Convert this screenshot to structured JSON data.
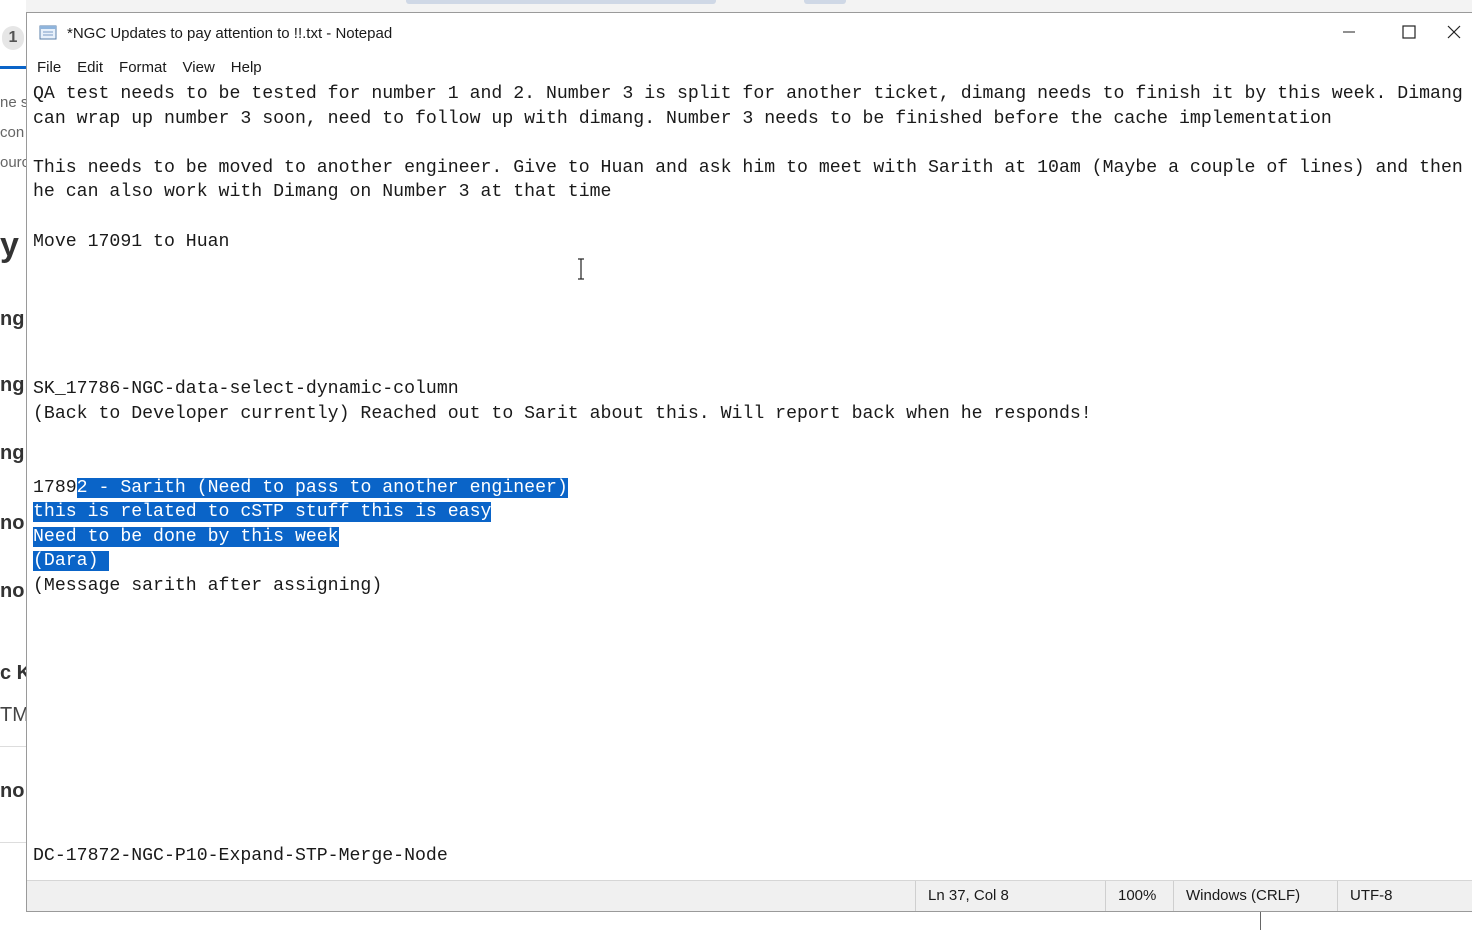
{
  "background_app": {
    "fragments": [
      "1",
      "ne s",
      "con",
      "ourc",
      "y",
      "ng",
      "ng",
      "ng",
      "no",
      "no",
      "c K",
      "TM",
      "no"
    ]
  },
  "window": {
    "title": "*NGC Updates to pay attention to !!.txt - Notepad",
    "app_icon": "notepad-icon",
    "controls": {
      "minimize_icon": "minimize-icon",
      "maximize_icon": "maximize-icon",
      "close_icon": "close-icon"
    }
  },
  "menu": {
    "items": [
      "File",
      "Edit",
      "Format",
      "View",
      "Help"
    ]
  },
  "editor": {
    "lines": [
      "QA test needs to be tested for number 1 and 2. Number 3 is split for another ticket, dimang needs to finish it by this week. Dimang",
      "can wrap up number 3 soon, need to follow up with dimang. Number 3 needs to be finished before the cache implementation",
      "",
      "This needs to be moved to another engineer. Give to Huan and ask him to meet with Sarith at 10am (Maybe a couple of lines) and then",
      "he can also work with Dimang on Number 3 at that time",
      "",
      "Move 17091 to Huan",
      "",
      "",
      "",
      "",
      "",
      "SK_17786-NGC-data-select-dynamic-column",
      "(Back to Developer currently) Reached out to Sarit about this. Will report back when he responds!",
      "",
      ""
    ],
    "selection_line_1_prefix": "1789",
    "selection_line_1_selected": "2 - Sarith (Need to pass to another engineer)",
    "selected_lines": [
      "this is related to cSTP stuff this is easy",
      "Need to be done by this week",
      "(Dara) "
    ],
    "after_selection": "(Message sarith after assigning)",
    "partial_bottom_line": "DC-17872-NGC-P10-Expand-STP-Merge-Node"
  },
  "status": {
    "position": "Ln 37, Col 8",
    "zoom": "100%",
    "line_ending": "Windows (CRLF)",
    "encoding": "UTF-8"
  },
  "colors": {
    "selection": "#0a64c8",
    "statusbar": "#f0f0f0"
  }
}
